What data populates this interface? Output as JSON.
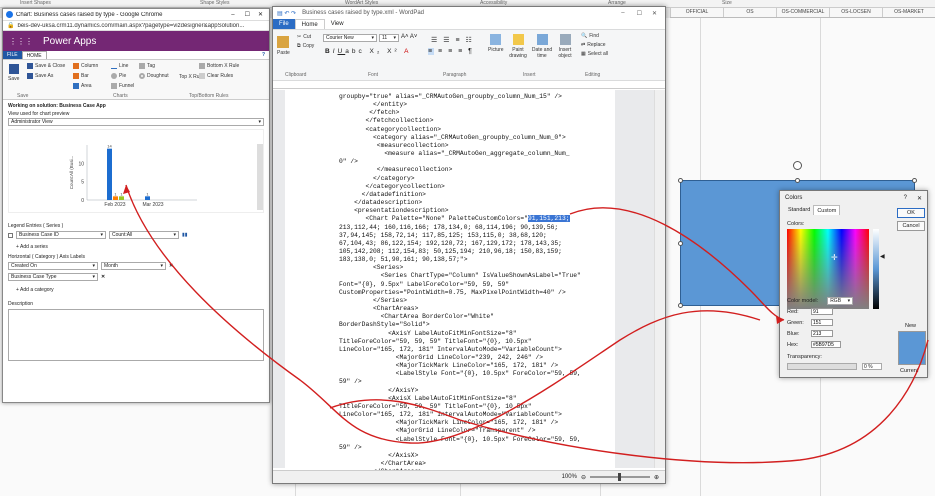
{
  "background": {
    "ribbon_labels": [
      "Insert Shapes",
      "Shape Styles",
      "WordArt Styles",
      "Accessibility",
      "Arrange",
      "Size"
    ],
    "tabs": [
      "OFFICIAL",
      "OS",
      "OS-COMMERCIAL",
      "OS-LOCSEN",
      "OS-MARKET"
    ]
  },
  "chrome": {
    "title": "Chart: Business cases raised by type - Google Chrome",
    "url": "beis-dev-uksa.crm11.dynamics.com/main.aspx?pagetype=vizdesigner&appSolution...",
    "app_name": "Power Apps",
    "tabs": [
      "FILE",
      "HOME"
    ],
    "ribbon": {
      "save": "Save",
      "save_close": "Save & Close",
      "save_as": "Save As",
      "column": "Column",
      "bar": "Bar",
      "area": "Area",
      "line": "Line",
      "pie": "Pie",
      "funnel": "Funnel",
      "tag": "Tag",
      "doughnut": "Doughnut",
      "top_x": "Top X Rule",
      "bottom_x": "Bottom X Rule",
      "clear_rules": "Clear Rules",
      "group_save": "Save",
      "group_charts": "Charts",
      "group_topbottom": "Top/Bottom Rules"
    },
    "working_on": "Working on solution: Business Case App",
    "view_label": "View used for chart preview",
    "view_value": "Administrator View",
    "chart_ylabel": "Count:All (Busi...",
    "legend_title": "Legend Entries ( Series )",
    "series_field": "Business Case ID",
    "series_agg": "Count:All",
    "add_series": "Add a series",
    "axis_title": "Horizontal ( Category ) Axis Labels",
    "axis_field": "Created On",
    "axis_group": "Month",
    "category_field": "Business Case Type",
    "add_category": "Add a category",
    "description_label": "Description"
  },
  "chart_data": {
    "type": "bar",
    "categories": [
      "Feb 2023",
      "Mar 2023"
    ],
    "series": [
      {
        "values": [
          14,
          1
        ],
        "color": "#1c6dd0"
      },
      {
        "values": [
          1,
          0
        ],
        "color": "#ff7f00"
      },
      {
        "values": [
          1,
          0
        ],
        "color": "#98c723"
      }
    ],
    "data_labels": [
      "14",
      "1",
      "1",
      "1"
    ],
    "ylim": [
      0,
      15
    ],
    "y_ticks": [
      "0",
      "5",
      "10"
    ]
  },
  "wordpad": {
    "title": "Business cases raised by type.xml - WordPad",
    "tabs": [
      "File",
      "Home",
      "View"
    ],
    "font_name": "Courier New",
    "font_size": "11",
    "groups": [
      "Clipboard",
      "Font",
      "Paragraph",
      "Insert",
      "Editing"
    ],
    "buttons": [
      "Paste",
      "Cut",
      "Copy",
      "Picture",
      "Paint drawing",
      "Date and time",
      "Insert object",
      "Find",
      "Replace",
      "Select all"
    ],
    "code_lines": [
      "groupby=\"true\" alias=\"_CRMAutoGen_groupby_column_Num_15\" />",
      "         </entity>",
      "        </fetch>",
      "       </fetchcollection>",
      "       <categorycollection>",
      "         <category alias=\"_CRMAutoGen_groupby_column_Num_0\">",
      "          <measurecollection>",
      "            <measure alias=\"_CRMAutoGen_aggregate_column_Num_",
      "0\" />",
      "          </measurecollection>",
      "         </category>",
      "       </categorycollection>",
      "      </datadefinition>",
      "    </datadescription>",
      "    <presentationdescription>",
      "       <Chart Palette=\"None\" PaletteCustomColors=\"",
      "213,112,44; 160,116,166; 178,134,0; 68,114,196; 90,139,56;",
      "37,94,145; 158,72,14; 117,85,125; 153,115,0; 38,68,120;",
      "67,104,43; 86,122,154; 192,120,72; 167,129,172; 178,143,35;",
      "105,142,208; 112,154,83; 50,125,194; 210,96,18; 150,83,159;",
      "183,138,0; 51,90,161; 90,138,57;\">",
      "         <Series>",
      "           <Series ChartType=\"Column\" IsValueShownAsLabel=\"True\"",
      "Font=\"{0}, 9.5px\" LabelForeColor=\"59, 59, 59\"",
      "CustomProperties=\"PointWidth=0.75, MaxPixelPointWidth=40\" />",
      "         </Series>",
      "         <ChartAreas>",
      "           <ChartArea BorderColor=\"White\"",
      "BorderDashStyle=\"Solid\">",
      "             <AxisY LabelAutoFitMinFontSize=\"8\"",
      "TitleForeColor=\"59, 59, 59\" TitleFont=\"{0}, 10.5px\"",
      "LineColor=\"165, 172, 181\" IntervalAutoMode=\"VariableCount\">",
      "               <MajorGrid LineColor=\"239, 242, 246\" />",
      "               <MajorTickMark LineColor=\"165, 172, 181\" />",
      "               <LabelStyle Font=\"{0}, 10.5px\" ForeColor=\"59, 59,",
      "59\" />",
      "             </AxisY>",
      "             <AxisX LabelAutoFitMinFontSize=\"8\"",
      "TitleForeColor=\"59, 59, 59\" TitleFont=\"{0}, 10.5px\"",
      "LineColor=\"165, 172, 181\" IntervalAutoMode=\"VariableCount\">",
      "               <MajorTickMark LineColor=\"165, 172, 181\" />",
      "               <MajorGrid LineColor=\"Transparent\" />",
      "               <LabelStyle Font=\"{0}, 10.5px\" ForeColor=\"59, 59,",
      "59\" />",
      "             </AxisX>",
      "           </ChartArea>",
      "         </ChartAreas>",
      "         <Titles>"
    ],
    "highlight": "91,151,213;",
    "zoom": "100%"
  },
  "colors_dialog": {
    "title": "Colors",
    "tabs": [
      "Standard",
      "Custom"
    ],
    "colors_label": "Colors:",
    "model_label": "Color model:",
    "model_value": "RGB",
    "red_label": "Red:",
    "red": "91",
    "green_label": "Green:",
    "green": "151",
    "blue_label": "Blue:",
    "blue": "213",
    "hex_label": "Hex:",
    "hex": "#5B97D5",
    "transparency_label": "Transparency:",
    "transparency": "0 %",
    "ok": "OK",
    "cancel": "Cancel",
    "new_label": "New",
    "current_label": "Current",
    "swatch_color": "#5b97d5"
  }
}
